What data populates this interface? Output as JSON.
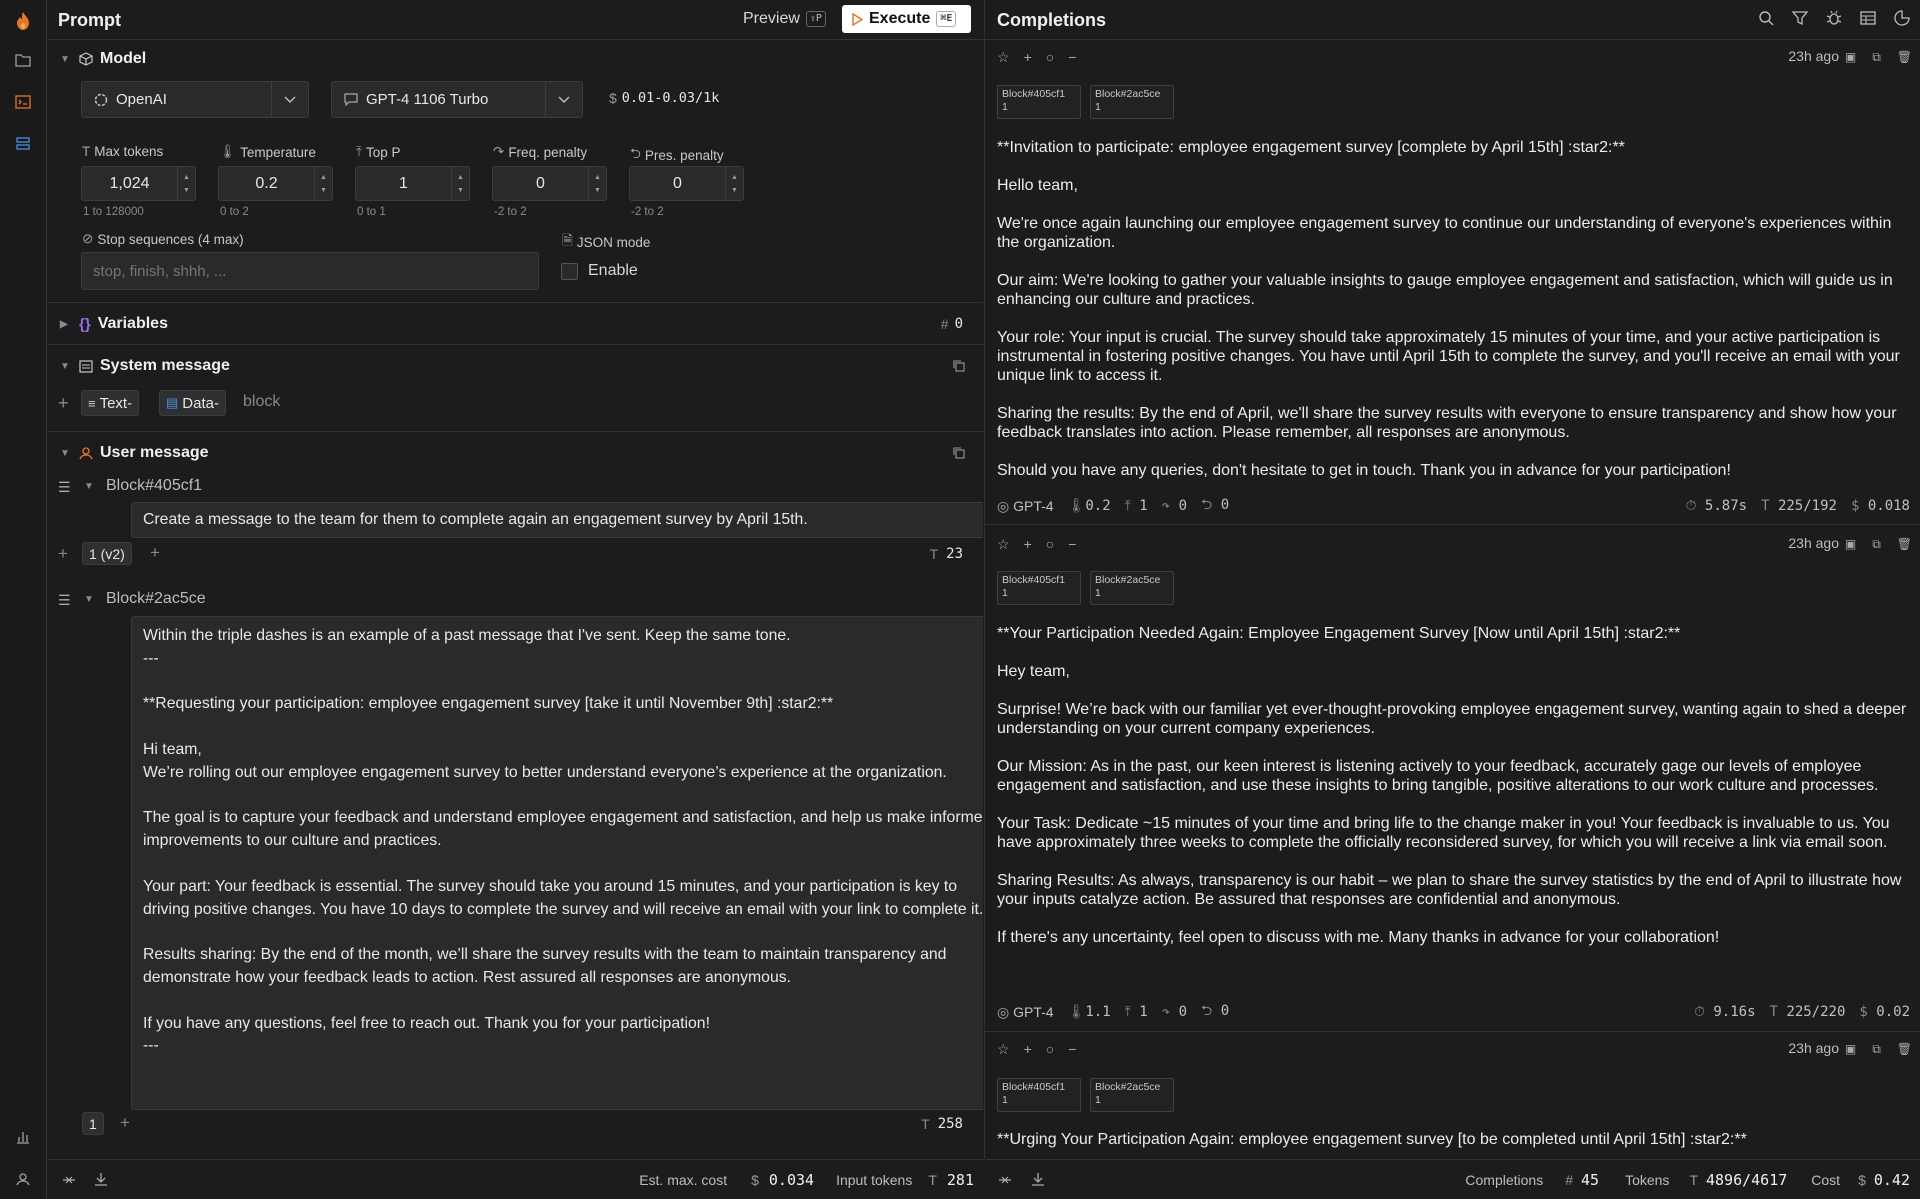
{
  "sidebar": {
    "items": [
      "flame-logo",
      "folder-icon",
      "prompt-icon",
      "stack-icon",
      "chart-icon",
      "user-icon"
    ]
  },
  "prompt": {
    "title": "Prompt",
    "preview_label": "Preview",
    "preview_shortcut": "⇧P",
    "execute_label": "Execute",
    "execute_shortcut": "⌘E",
    "model_section": "Model",
    "provider": "OpenAI",
    "model": "GPT-4 1106 Turbo",
    "price": "0.01-0.03/1k",
    "params": [
      {
        "label": "Max tokens",
        "value": "1,024",
        "range": "1 to 128000"
      },
      {
        "label": "Temperature",
        "value": "0.2",
        "range": "0 to 2"
      },
      {
        "label": "Top P",
        "value": "1",
        "range": "0 to 1"
      },
      {
        "label": "Freq. penalty",
        "value": "0",
        "range": "-2 to 2"
      },
      {
        "label": "Pres. penalty",
        "value": "0",
        "range": "-2 to 2"
      }
    ],
    "stop_label": "Stop sequences (4 max)",
    "stop_placeholder": "stop, finish, shhh, ...",
    "json_label": "JSON mode",
    "json_enable": "Enable",
    "variables_label": "Variables",
    "variables_count": "0",
    "system_label": "System message",
    "text_chip": "Text-",
    "data_chip": "Data-",
    "block_label": "block",
    "user_label": "User message",
    "block1": {
      "name": "Block#405cf1",
      "text": "Create a message to the team for them to complete again an engagement survey by April 15th.",
      "version": "1 (v2)",
      "tokens": "23"
    },
    "block2": {
      "name": "Block#2ac5ce",
      "text": "Within the triple dashes is an example of a past message that I've sent. Keep the same tone.\n---\n\n**Requesting your participation: employee engagement survey [take it until November 9th] :star2:**\n\nHi team,\nWe’re rolling out our employee engagement survey to better understand everyone’s experience at the organization.\n\nThe goal is to capture your feedback and understand employee engagement and satisfaction, and help us make informed improvements to our culture and practices.\n\nYour part: Your feedback is essential. The survey should take you around 15 minutes, and your participation is key to driving positive changes. You have 10 days to complete the survey and will receive an email with your link to complete it.\n\nResults sharing: By the end of the month, we’ll share the survey results with the team to maintain transparency and demonstrate how your feedback leads to action. Rest assured all responses are anonymous.\n\nIf you have any questions, feel free to reach out. Thank you for your participation!\n---",
      "version": "1",
      "tokens": "258"
    },
    "footer": {
      "cost_label": "Est. max. cost",
      "cost_value": "0.034",
      "input_label": "Input tokens",
      "input_value": "281"
    }
  },
  "completions": {
    "title": "Completions",
    "items": [
      {
        "ago": "23h ago",
        "tag1": "Block#405cf1",
        "tag1_v": "1",
        "tag2": "Block#2ac5ce",
        "tag2_v": "1",
        "paragraphs": [
          "**Invitation to participate: employee engagement survey [complete by April 15th] :star2:**",
          "Hello team,",
          "We're once again launching our employee engagement survey to continue our understanding of everyone's experiences within the organization.",
          "Our aim: We're looking to gather your valuable insights to gauge employee engagement and satisfaction, which will guide us in enhancing our culture and practices.",
          "Your role: Your input is crucial. The survey should take approximately 15 minutes of your time, and your active participation is instrumental in fostering positive changes. You have until April 15th to complete the survey, and you'll receive an email with your unique link to access it.",
          "Sharing the results: By the end of April, we'll share the survey results with everyone to ensure transparency and show how your feedback translates into action. Please remember, all responses are anonymous.",
          "Should you have any queries, don't hesitate to get in touch. Thank you in advance for your participation!"
        ],
        "model": "GPT-4",
        "temp": "0.2",
        "top_p": "1",
        "freq": "0",
        "pres": "0",
        "time": "5.87s",
        "tokens": "225/192",
        "cost": "0.018"
      },
      {
        "ago": "23h ago",
        "tag1": "Block#405cf1",
        "tag1_v": "1",
        "tag2": "Block#2ac5ce",
        "tag2_v": "1",
        "paragraphs": [
          "**Your Participation Needed Again: Employee Engagement Survey [Now until April 15th] :star2:**",
          "Hey team,",
          "Surprise! We’re back with our familiar yet ever-thought-provoking employee engagement survey, wanting again to shed a deeper understanding on your current company experiences.",
          "Our Mission: As in the past, our keen interest is listening actively to your feedback, accurately gage our levels of employee engagement and satisfaction, and use these insights to bring tangible, positive alterations to our work culture and processes.",
          "Your Task: Dedicate ~15 minutes of your time and bring life to the change maker in you! Your feedback is invaluable to us. You have approximately three weeks to complete the officially reconsidered survey, for which you will receive a link via email soon.",
          "Sharing Results: As always, transparency is our habit – we plan to share the survey statistics by the end of April to illustrate how your inputs catalyze action. Be assured that responses are confidential and anonymous.",
          "If there's any uncertainty, feel open to discuss with me. Many thanks in advance for your collaboration!"
        ],
        "model": "GPT-4",
        "temp": "1.1",
        "top_p": "1",
        "freq": "0",
        "pres": "0",
        "time": "9.16s",
        "tokens": "225/220",
        "cost": "0.02"
      },
      {
        "ago": "23h ago",
        "tag1": "Block#405cf1",
        "tag1_v": "1",
        "tag2": "Block#2ac5ce",
        "tag2_v": "1",
        "paragraphs": [
          "**Urging Your Participation Again: employee engagement survey [to be completed until April 15th] :star2:**"
        ]
      }
    ],
    "footer": {
      "completions_label": "Completions",
      "completions_value": "45",
      "tokens_label": "Tokens",
      "tokens_value": "4896/4617",
      "cost_label": "Cost",
      "cost_value": "0.42"
    }
  },
  "colors": {
    "background": "#1c1c1e",
    "accent_orange": "#e8742c",
    "accent_blue": "#4a8fe0",
    "execute_bg": "#ffffff"
  }
}
